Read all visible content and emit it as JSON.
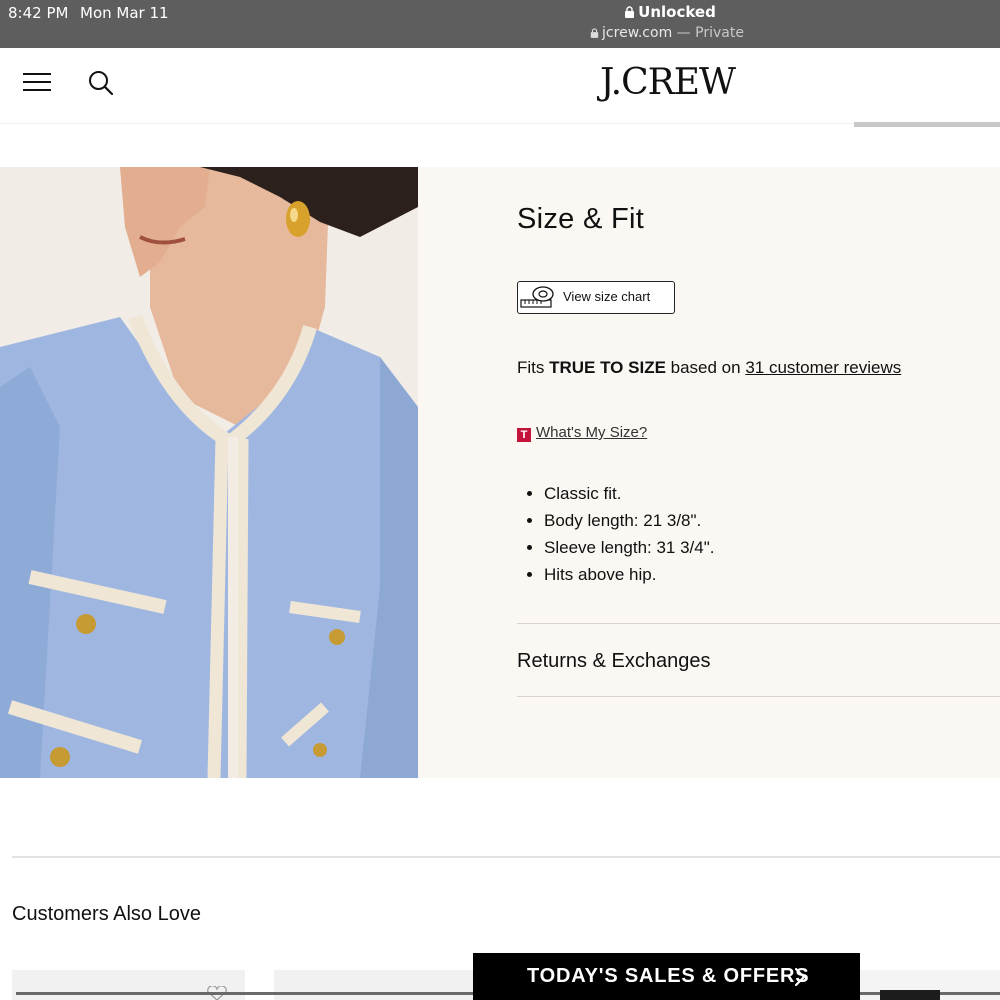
{
  "status_bar": {
    "time": "8:42 PM",
    "date": "Mon Mar 11",
    "lock_status": "Unlocked",
    "url": "jcrew.com",
    "url_suffix": "— Private"
  },
  "header": {
    "logo": "J.CREW",
    "icons": {
      "menu": "hamburger-menu-icon",
      "search": "search-icon"
    }
  },
  "size_fit": {
    "title": "Size & Fit",
    "size_chart_label": "View size chart",
    "fits_prefix": "Fits ",
    "fits_emphasis": "TRUE TO SIZE",
    "fits_middle": " based on ",
    "reviews_link": "31 customer reviews",
    "whats_my_size_badge": "T",
    "whats_my_size": "What's My Size?",
    "details": [
      "Classic fit.",
      "Body length: 21 3/8\".",
      "Sleeve length: 31 3/4\".",
      "Hits above hip."
    ],
    "returns": "Returns & Exchanges"
  },
  "recommendations": {
    "title": "Customers Also Love"
  },
  "sales_banner": {
    "label": "TODAY'S SALES & OFFERS"
  },
  "colors": {
    "status_bar_bg": "#5e5e5e",
    "info_panel_bg": "#fbf7f3",
    "jacket_blue": "#9fb7e0",
    "trim_cream": "#efe6d6",
    "badge_red": "#c4143c",
    "banner_bg": "#000000"
  }
}
